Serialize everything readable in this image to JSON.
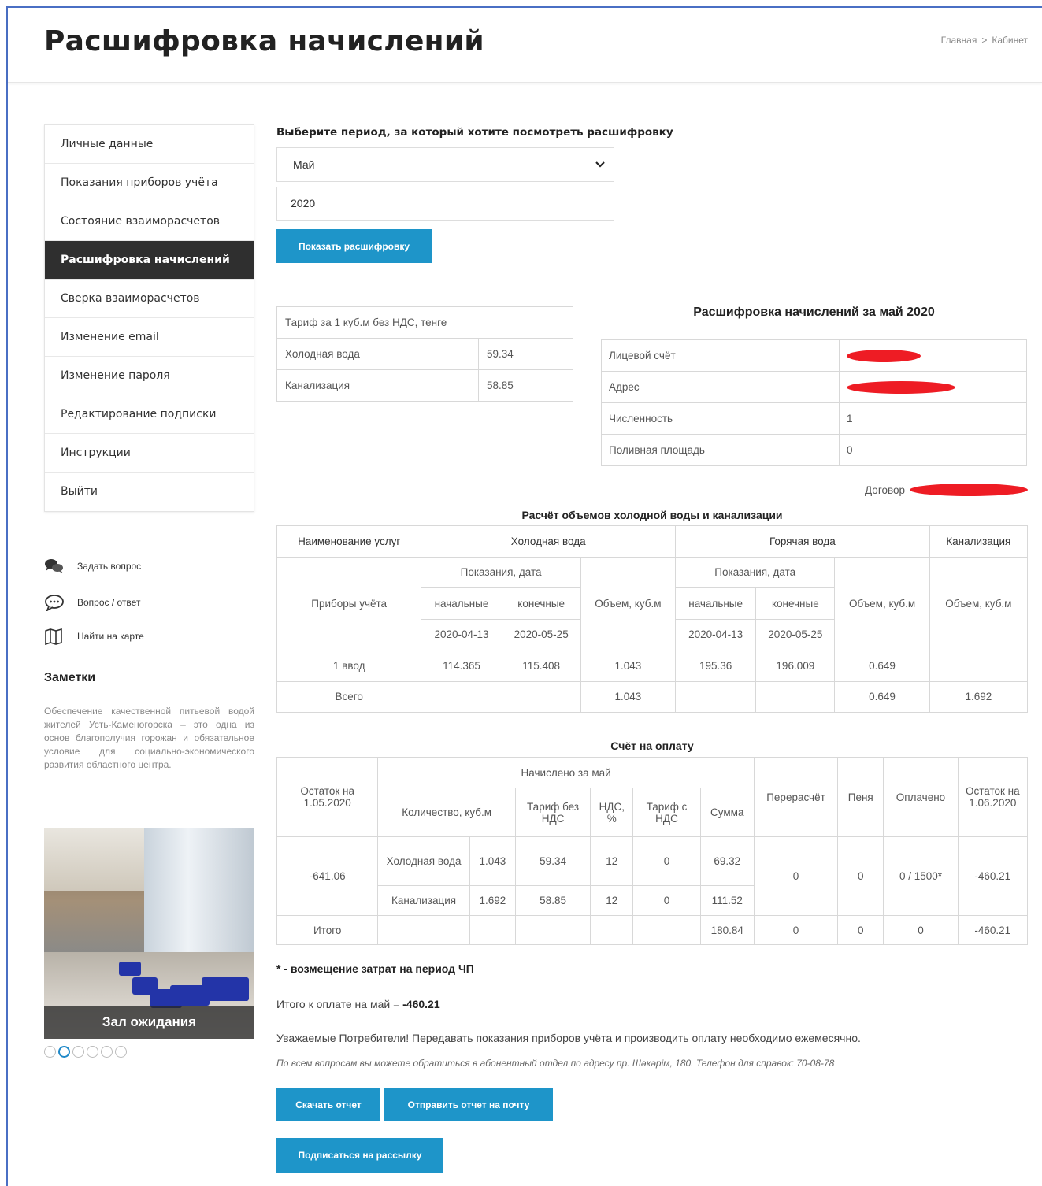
{
  "header": {
    "title": "Расшифровка начислений",
    "breadcrumb": [
      "Главная",
      "Кабинет"
    ],
    "breadcrumb_sep": ">"
  },
  "sidebar": {
    "items": [
      {
        "label": "Личные данные"
      },
      {
        "label": "Показания приборов учёта"
      },
      {
        "label": "Состояние взаиморасчетов"
      },
      {
        "label": "Расшифровка начислений",
        "active": true
      },
      {
        "label": "Сверка взаиморасчетов"
      },
      {
        "label": "Изменение email"
      },
      {
        "label": "Изменение пароля"
      },
      {
        "label": "Редактирование подписки"
      },
      {
        "label": "Инструкции"
      },
      {
        "label": "Выйти"
      }
    ],
    "links": [
      {
        "label": "Задать вопрос",
        "icon": "chat-icon"
      },
      {
        "label": "Вопрос / ответ",
        "icon": "speech-bubble-icon"
      },
      {
        "label": "Найти на карте",
        "icon": "map-icon"
      }
    ],
    "notes_title": "Заметки",
    "notes_text": "Обеспечение качественной питьевой водой жителей Усть-Каменогорска – это одна из основ благополучия горожан и обязательное условие для социально-экономического развития областного центра.",
    "photo_caption": "Зал ожидания",
    "carousel": {
      "count": 6,
      "active_index": 1
    }
  },
  "form": {
    "label": "Выберите период, за который хотите посмотреть расшифровку",
    "month": "Май",
    "year": "2020",
    "show_button": "Показать расшифровку"
  },
  "tariff": {
    "header": "Тариф за 1 куб.м без НДС, тенге",
    "rows": [
      {
        "name": "Холодная вода",
        "value": "59.34"
      },
      {
        "name": "Канализация",
        "value": "58.85"
      }
    ]
  },
  "decode": {
    "title": "Расшифровка начислений за май 2020",
    "rows": [
      {
        "key": "Лицевой счёт",
        "value": ""
      },
      {
        "key": "Адрес",
        "value": ""
      },
      {
        "key": "Численность",
        "value": "1"
      },
      {
        "key": "Поливная площадь",
        "value": "0"
      }
    ],
    "contract_label": "Договор"
  },
  "volumes": {
    "title": "Расчёт объемов холодной воды и канализации",
    "h_service": "Наименование услуг",
    "h_cold": "Холодная вода",
    "h_hot": "Горячая вода",
    "h_sewer": "Канализация",
    "h_readings": "Показания, дата",
    "h_meters": "Приборы учёта",
    "h_start": "начальные",
    "h_end": "конечные",
    "h_volume": "Объем, куб.м",
    "cold_start_date": "2020-04-13",
    "cold_end_date": "2020-05-25",
    "hot_start_date": "2020-04-13",
    "hot_end_date": "2020-05-25",
    "row1": {
      "name": "1 ввод",
      "cold_start": "114.365",
      "cold_end": "115.408",
      "cold_vol": "1.043",
      "hot_start": "195.36",
      "hot_end": "196.009",
      "hot_vol": "0.649",
      "sewer_vol": ""
    },
    "total": {
      "name": "Всего",
      "cold_vol": "1.043",
      "hot_vol": "0.649",
      "sewer_vol": "1.692"
    }
  },
  "bill": {
    "title": "Счёт на оплату",
    "h_balance_start": "Остаток на 1.05.2020",
    "h_charged": "Начислено за май",
    "h_qty": "Количество, куб.м",
    "h_tariff_no_vat": "Тариф без НДС",
    "h_vat": "НДС, %",
    "h_tariff_vat": "Тариф с НДС",
    "h_sum": "Сумма",
    "h_recalc": "Перерасчёт",
    "h_penalty": "Пеня",
    "h_paid": "Оплачено",
    "h_balance_end": "Остаток на 1.06.2020",
    "balance_start": "-641.06",
    "rows": [
      {
        "name": "Холодная вода",
        "qty": "1.043",
        "tariff": "59.34",
        "vat": "12",
        "tariff_vat": "0",
        "sum": "69.32"
      },
      {
        "name": "Канализация",
        "qty": "1.692",
        "tariff": "58.85",
        "vat": "12",
        "tariff_vat": "0",
        "sum": "111.52"
      }
    ],
    "recalc": "0",
    "penalty": "0",
    "paid": "0 / 1500*",
    "balance_end": "-460.21",
    "total": {
      "name": "Итого",
      "sum": "180.84",
      "recalc": "0",
      "penalty": "0",
      "paid": "0",
      "balance_end": "-460.21"
    }
  },
  "footer": {
    "star_note": "* - возмещение затрат на период ЧП",
    "total_label": "Итого к оплате на май = ",
    "total_value": "-460.21",
    "notice": "Уважаемые Потребители! Передавать показания приборов учёта и производить оплату необходимо ежемесячно.",
    "contact": "По всем вопросам вы можете обратиться в абонентный отдел по адресу пр. Шәкәрім, 180. Телефон для справок: 70-08-78",
    "download_button": "Скачать отчет",
    "email_button": "Отправить отчет на почту",
    "subscribe_button": "Подписаться на рассылку"
  },
  "colors": {
    "accent": "#1e95c9",
    "active_menu": "#2f2f2f",
    "redaction": "#ee1c24"
  }
}
